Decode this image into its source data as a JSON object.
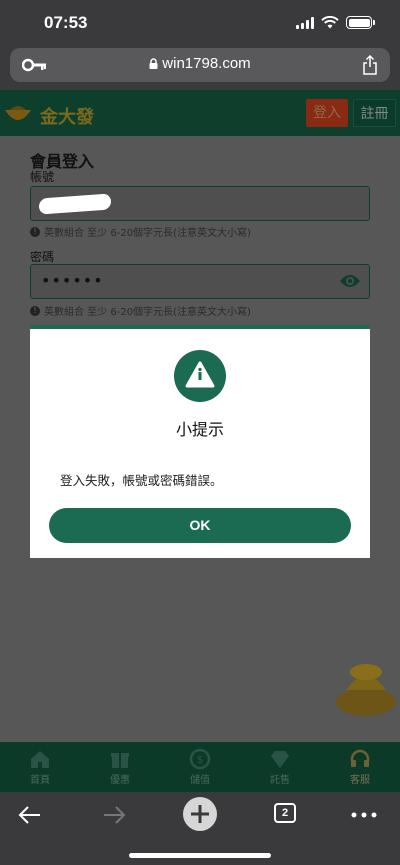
{
  "status_bar": {
    "time": "07:53"
  },
  "browser": {
    "url": "win1798.com",
    "tab_count": "2"
  },
  "site": {
    "name": "金大發",
    "login_label": "登入",
    "register_label": "註冊"
  },
  "form": {
    "title": "會員登入",
    "account_label": "帳號",
    "account_hint": "英數組合 至少 6-20個字元長(注意英文大小寫)",
    "password_label": "密碼",
    "password_value": "••••••",
    "password_hint": "英數組合 至少 6-20個字元長(注意英文大小寫)"
  },
  "modal": {
    "title": "小提示",
    "message": "登入失敗，帳號或密碼錯誤。",
    "ok_label": "OK"
  },
  "bottom_nav": {
    "items": [
      {
        "label": "首頁",
        "icon": "home-icon"
      },
      {
        "label": "優惠",
        "icon": "gift-icon"
      },
      {
        "label": "儲值",
        "icon": "coin-icon"
      },
      {
        "label": "託售",
        "icon": "diamond-icon"
      },
      {
        "label": "客服",
        "icon": "headset-icon"
      }
    ]
  },
  "colors": {
    "primary_green": "#1b6b52",
    "header_green": "#0e3f2d",
    "login_red": "#8a2a12"
  }
}
